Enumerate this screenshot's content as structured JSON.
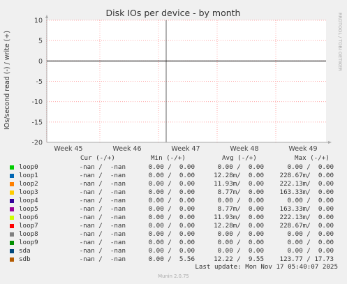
{
  "chart_data": {
    "type": "line",
    "title": "Disk IOs per device - by month",
    "ylabel": "IOs/second read (-) / write (+)",
    "side_label": "RRDTOOL / TOBI OETIKER",
    "ylim": [
      -20,
      10
    ],
    "yticks": [
      -20,
      -15,
      -10,
      -5,
      0,
      5,
      10
    ],
    "xticks": [
      "Week 45",
      "Week 46",
      "Week 47",
      "Week 48",
      "Week 49"
    ],
    "series": [
      {
        "name": "loop0",
        "color": "#00cc00"
      },
      {
        "name": "loop1",
        "color": "#0066b3"
      },
      {
        "name": "loop2",
        "color": "#ff8000"
      },
      {
        "name": "loop3",
        "color": "#ffcc00"
      },
      {
        "name": "loop4",
        "color": "#330099"
      },
      {
        "name": "loop5",
        "color": "#990099"
      },
      {
        "name": "loop6",
        "color": "#ccff00"
      },
      {
        "name": "loop7",
        "color": "#ff0000"
      },
      {
        "name": "loop8",
        "color": "#808080"
      },
      {
        "name": "loop9",
        "color": "#008f00"
      },
      {
        "name": "sda",
        "color": "#00487d"
      },
      {
        "name": "sdb",
        "color": "#b35a00"
      }
    ]
  },
  "legend": {
    "headers": {
      "cur": "Cur (-/+)",
      "min": "Min (-/+)",
      "avg": "Avg (-/+)",
      "max": "Max (-/+)"
    },
    "rows": [
      {
        "cur": "-nan /  -nan",
        "min": "0.00 /  0.00",
        "avg": "0.00 /  0.00",
        "max": "0.00 /  0.00"
      },
      {
        "cur": "-nan /  -nan",
        "min": "0.00 /  0.00",
        "avg": "12.28m/  0.00",
        "max": "228.67m/  0.00"
      },
      {
        "cur": "-nan /  -nan",
        "min": "0.00 /  0.00",
        "avg": "11.93m/  0.00",
        "max": "222.13m/  0.00"
      },
      {
        "cur": "-nan /  -nan",
        "min": "0.00 /  0.00",
        "avg": "8.77m/  0.00",
        "max": "163.33m/  0.00"
      },
      {
        "cur": "-nan /  -nan",
        "min": "0.00 /  0.00",
        "avg": "0.00 /  0.00",
        "max": "0.00 /  0.00"
      },
      {
        "cur": "-nan /  -nan",
        "min": "0.00 /  0.00",
        "avg": "8.77m/  0.00",
        "max": "163.33m/  0.00"
      },
      {
        "cur": "-nan /  -nan",
        "min": "0.00 /  0.00",
        "avg": "11.93m/  0.00",
        "max": "222.13m/  0.00"
      },
      {
        "cur": "-nan /  -nan",
        "min": "0.00 /  0.00",
        "avg": "12.28m/  0.00",
        "max": "228.67m/  0.00"
      },
      {
        "cur": "-nan /  -nan",
        "min": "0.00 /  0.00",
        "avg": "0.00 /  0.00",
        "max": "0.00 /  0.00"
      },
      {
        "cur": "-nan /  -nan",
        "min": "0.00 /  0.00",
        "avg": "0.00 /  0.00",
        "max": "0.00 /  0.00"
      },
      {
        "cur": "-nan /  -nan",
        "min": "0.00 /  0.00",
        "avg": "0.00 /  0.00",
        "max": "0.00 /  0.00"
      },
      {
        "cur": "-nan /  -nan",
        "min": "0.00 /  5.56",
        "avg": "12.22 /  9.55",
        "max": "123.77 / 17.73"
      }
    ]
  },
  "footer": {
    "last_update": "Last update: Mon Nov 17 05:40:07 2025",
    "version": "Munin 2.0.75"
  }
}
